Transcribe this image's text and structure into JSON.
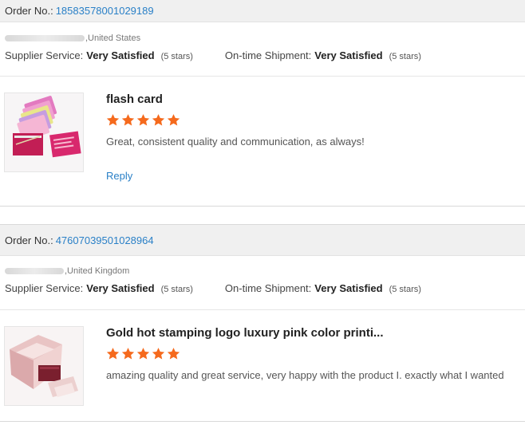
{
  "orders": [
    {
      "order_label": "Order No.:",
      "order_number": "18583578001029189",
      "buyer_location": ",United States",
      "supplier_service_label": "Supplier Service:",
      "supplier_service_value": "Very Satisfied",
      "supplier_service_stars": "(5 stars)",
      "shipment_label": "On-time Shipment:",
      "shipment_value": "Very Satisfied",
      "shipment_stars": "(5 stars)",
      "product_title": "flash card",
      "rating": 5,
      "comment": "Great, consistent quality and communication, as always!",
      "reply_label": "Reply",
      "thumbnail_icon": "flash-card-product-image"
    },
    {
      "order_label": "Order No.:",
      "order_number": "47607039501028964",
      "buyer_location": ",United Kingdom",
      "supplier_service_label": "Supplier Service:",
      "supplier_service_value": "Very Satisfied",
      "supplier_service_stars": "(5 stars)",
      "shipment_label": "On-time Shipment:",
      "shipment_value": "Very Satisfied",
      "shipment_stars": "(5 stars)",
      "product_title": "Gold hot stamping logo luxury pink color printi...",
      "rating": 5,
      "comment": "amazing quality and great service, very happy with the product I. exactly what I wanted",
      "thumbnail_icon": "pink-gift-box-product-image"
    }
  ],
  "colors": {
    "link": "#2a80c7",
    "star": "#f56a1d",
    "header_bg": "#f0f0f0"
  }
}
